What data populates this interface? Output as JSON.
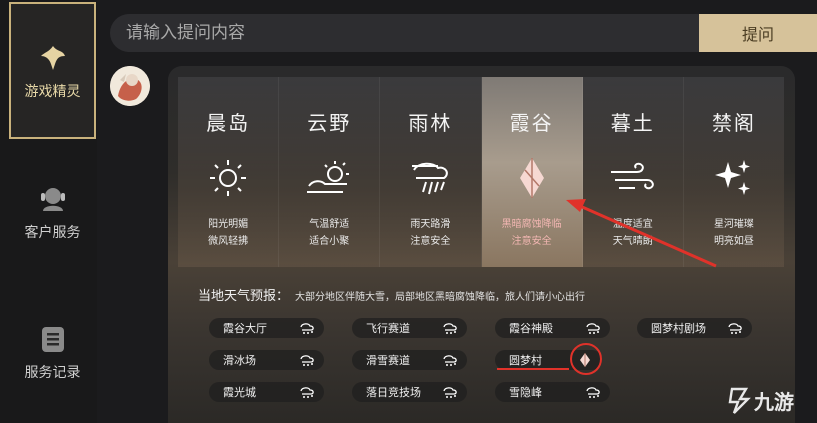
{
  "sidebar": {
    "items": [
      {
        "label": "游戏精灵",
        "icon": "fairy-icon",
        "active": true
      },
      {
        "label": "客户服务",
        "icon": "headset-icon",
        "active": false
      },
      {
        "label": "服务记录",
        "icon": "clipboard-icon",
        "active": false
      }
    ]
  },
  "search": {
    "placeholder": "请输入提问内容",
    "button_label": "提问"
  },
  "regions": [
    {
      "name": "晨岛",
      "icon": "sun-icon",
      "line1": "阳光明媚",
      "line2": "微风轻拂"
    },
    {
      "name": "云野",
      "icon": "partly-cloudy-icon",
      "line1": "气温舒适",
      "line2": "适合小聚"
    },
    {
      "name": "雨林",
      "icon": "rain-icon",
      "line1": "雨天路滑",
      "line2": "注意安全"
    },
    {
      "name": "霞谷",
      "icon": "dark-crystal-icon",
      "line1": "黑暗腐蚀降临",
      "line2": "注意安全",
      "selected": true
    },
    {
      "name": "暮土",
      "icon": "wind-icon",
      "line1": "温度适宜",
      "line2": "天气晴朗"
    },
    {
      "name": "禁阁",
      "icon": "sparkle-icon",
      "line1": "星河璀璨",
      "line2": "明亮如昼"
    }
  ],
  "forecast": {
    "label": "当地天气预报：",
    "detail": "大部分地区伴随大雪，局部地区黑暗腐蚀降临，旅人们请小心出行"
  },
  "locations": [
    {
      "name": "霞谷大厅",
      "icon": "snow-icon"
    },
    {
      "name": "飞行赛道",
      "icon": "snow-icon"
    },
    {
      "name": "霞谷神殿",
      "icon": "snow-icon"
    },
    {
      "name": "圆梦村剧场",
      "icon": "snow-icon"
    },
    {
      "name": "滑冰场",
      "icon": "snow-icon"
    },
    {
      "name": "滑雪赛道",
      "icon": "snow-icon"
    },
    {
      "name": "圆梦村",
      "icon": "dark-crystal-icon"
    },
    {
      "name": "霞光城",
      "icon": "snow-icon"
    },
    {
      "name": "落日竞技场",
      "icon": "snow-icon"
    },
    {
      "name": "雪隐峰",
      "icon": "snow-icon"
    }
  ],
  "watermark": {
    "text": "九游"
  },
  "colors": {
    "accent": "#d6c29a",
    "highlight": "#e0322a",
    "selected_text": "#f2b6b2"
  }
}
